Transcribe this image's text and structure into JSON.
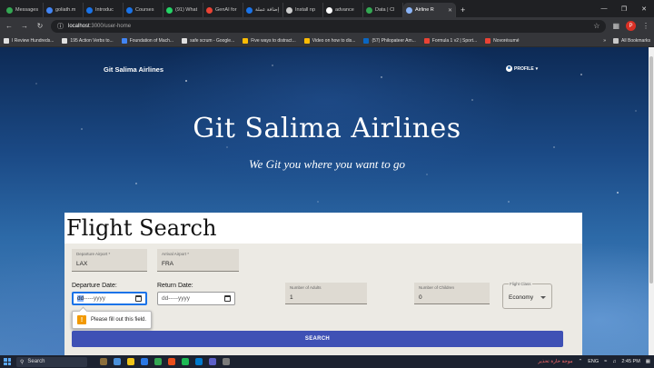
{
  "browser": {
    "tabs": [
      {
        "title": "Messages",
        "color": "#34a853"
      },
      {
        "title": "goliath.m",
        "color": "#4285f4"
      },
      {
        "title": "Introduc",
        "color": "#1a73e8"
      },
      {
        "title": "Courses",
        "color": "#1a73e8"
      },
      {
        "title": "(91) What",
        "color": "#25d366"
      },
      {
        "title": "GenAI for",
        "color": "#ea4335"
      },
      {
        "title": "إضافة عملة",
        "color": "#1a73e8"
      },
      {
        "title": "Install np",
        "color": "#cccccc"
      },
      {
        "title": "advance",
        "color": "#ffffff"
      },
      {
        "title": "Data | Cl",
        "color": "#34a853"
      },
      {
        "title": "Airline R",
        "color": "#8ab4f8",
        "active": true
      }
    ],
    "url_host": "localhost",
    "url_path": ":3000/user-home",
    "profile_initial": "P",
    "bookmarks": [
      "I Review Hundreds...",
      "195 Action Verbs to...",
      "Foundation of Mach...",
      "safe scrum - Google...",
      "Five ways to distract...",
      "Video on how to dis...",
      "(57) Philopateer Am...",
      "Formula 1 v2 | Sport...",
      "Novorésumé"
    ],
    "all_bookmarks": "All Bookmarks"
  },
  "navbar": {
    "brand": "Git Salima Airlines",
    "profile_label": "PROFILE"
  },
  "hero": {
    "title": "Git Salima Airlines",
    "subtitle": "We Git you where you want to go"
  },
  "form": {
    "title": "Flight Search",
    "departure_airport": {
      "label": "Departure Airport *",
      "value": "LAX"
    },
    "arrival_airport": {
      "label": "Arrival Airport *",
      "value": "FRA"
    },
    "departure_date": {
      "label": "Departure Date:",
      "selected": "dd",
      "rest": "-----yyyy"
    },
    "return_date": {
      "label": "Return Date:",
      "placeholder": "dd-----yyyy"
    },
    "adults": {
      "label": "Number of Adults",
      "value": "1"
    },
    "children": {
      "label": "Number of Children",
      "value": "0"
    },
    "flight_class": {
      "label": "Flight Class",
      "value": "Economy"
    },
    "validation_message": "Please fill out this field.",
    "search_label": "SEARCH"
  },
  "taskbar": {
    "search_label": "Search",
    "alert_text": "موجة حارة تحذير",
    "lang": "ENG",
    "time": "2:45 PM"
  },
  "colors": {
    "primary_button": "#3f51b5",
    "focus_ring": "#1a73e8",
    "warning": "#f29900"
  }
}
